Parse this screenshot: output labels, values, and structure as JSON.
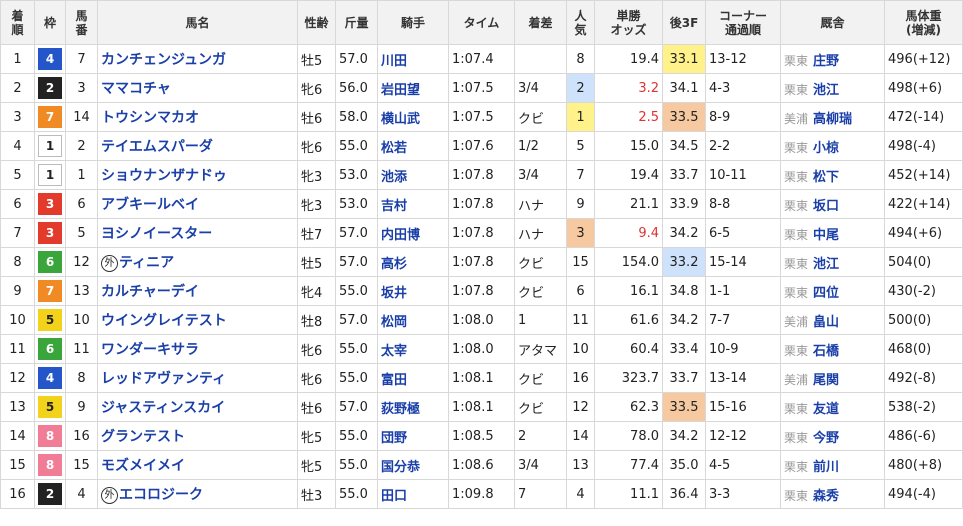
{
  "headers": {
    "rank": "着順",
    "waku": "枠",
    "umaban": "馬番",
    "horse": "馬名",
    "sexage": "性齢",
    "weight": "斤量",
    "jockey": "騎手",
    "time": "タイム",
    "margin": "着差",
    "popularity": "人気",
    "odds": "単勝オッズ",
    "last3f": "後3F",
    "corner": "コーナー通過順",
    "trainer": "厩舎",
    "bodyweight": "馬体重(増減)"
  },
  "header_parts": {
    "rank_1": "着",
    "rank_2": "順",
    "umaban_1": "馬",
    "umaban_2": "番",
    "pop_1": "人",
    "pop_2": "気",
    "odds_1": "単勝",
    "odds_2": "オッズ",
    "corner_1": "コーナー",
    "corner_2": "通過順",
    "bw_1": "馬体重",
    "bw_2": "(増減)"
  },
  "gai_mark": "外",
  "waku_colors": {
    "1": {
      "bg": "#ffffff",
      "fg": "#222222",
      "border": "#bbbbbb"
    },
    "2": {
      "bg": "#222222",
      "fg": "#ffffff",
      "border": "#222222"
    },
    "3": {
      "bg": "#e23b2c",
      "fg": "#ffffff",
      "border": "#e23b2c"
    },
    "4": {
      "bg": "#2456c9",
      "fg": "#ffffff",
      "border": "#2456c9"
    },
    "5": {
      "bg": "#f2d21b",
      "fg": "#222222",
      "border": "#f2d21b"
    },
    "6": {
      "bg": "#3aa53a",
      "fg": "#ffffff",
      "border": "#3aa53a"
    },
    "7": {
      "bg": "#f08a25",
      "fg": "#ffffff",
      "border": "#f08a25"
    },
    "8": {
      "bg": "#f07c96",
      "fg": "#ffffff",
      "border": "#f07c96"
    }
  },
  "rows": [
    {
      "rank": "1",
      "waku": "4",
      "umaban": "7",
      "horse": "カンチェンジュンガ",
      "gai": false,
      "sexage": "牡5",
      "weight": "57.0",
      "jockey": "川田",
      "time": "1:07.4",
      "margin": "",
      "pop": "8",
      "pop_hl": "",
      "odds": "19.4",
      "odds_red": false,
      "last3f": "33.1",
      "l3_hl": "yellow",
      "corner": "13-12",
      "area": "栗東",
      "trainer": "庄野",
      "bw": "496(+12)"
    },
    {
      "rank": "2",
      "waku": "2",
      "umaban": "3",
      "horse": "ママコチャ",
      "gai": false,
      "sexage": "牝6",
      "weight": "56.0",
      "jockey": "岩田望",
      "time": "1:07.5",
      "margin": "3/4",
      "pop": "2",
      "pop_hl": "blue",
      "odds": "3.2",
      "odds_red": true,
      "last3f": "34.1",
      "l3_hl": "",
      "corner": "4-3",
      "area": "栗東",
      "trainer": "池江",
      "bw": "498(+6)"
    },
    {
      "rank": "3",
      "waku": "7",
      "umaban": "14",
      "horse": "トウシンマカオ",
      "gai": false,
      "sexage": "牡6",
      "weight": "58.0",
      "jockey": "横山武",
      "time": "1:07.5",
      "margin": "クビ",
      "pop": "1",
      "pop_hl": "yellow",
      "odds": "2.5",
      "odds_red": true,
      "last3f": "33.5",
      "l3_hl": "orange",
      "corner": "8-9",
      "area": "美浦",
      "trainer": "高柳瑞",
      "bw": "472(-14)"
    },
    {
      "rank": "4",
      "waku": "1",
      "umaban": "2",
      "horse": "テイエムスパーダ",
      "gai": false,
      "sexage": "牝6",
      "weight": "55.0",
      "jockey": "松若",
      "time": "1:07.6",
      "margin": "1/2",
      "pop": "5",
      "pop_hl": "",
      "odds": "15.0",
      "odds_red": false,
      "last3f": "34.5",
      "l3_hl": "",
      "corner": "2-2",
      "area": "栗東",
      "trainer": "小椋",
      "bw": "498(-4)"
    },
    {
      "rank": "5",
      "waku": "1",
      "umaban": "1",
      "horse": "ショウナンザナドゥ",
      "gai": false,
      "sexage": "牝3",
      "weight": "53.0",
      "jockey": "池添",
      "time": "1:07.8",
      "margin": "3/4",
      "pop": "7",
      "pop_hl": "",
      "odds": "19.4",
      "odds_red": false,
      "last3f": "33.7",
      "l3_hl": "",
      "corner": "10-11",
      "area": "栗東",
      "trainer": "松下",
      "bw": "452(+14)"
    },
    {
      "rank": "6",
      "waku": "3",
      "umaban": "6",
      "horse": "アブキールベイ",
      "gai": false,
      "sexage": "牝3",
      "weight": "53.0",
      "jockey": "吉村",
      "time": "1:07.8",
      "margin": "ハナ",
      "pop": "9",
      "pop_hl": "",
      "odds": "21.1",
      "odds_red": false,
      "last3f": "33.9",
      "l3_hl": "",
      "corner": "8-8",
      "area": "栗東",
      "trainer": "坂口",
      "bw": "422(+14)"
    },
    {
      "rank": "7",
      "waku": "3",
      "umaban": "5",
      "horse": "ヨシノイースター",
      "gai": false,
      "sexage": "牡7",
      "weight": "57.0",
      "jockey": "内田博",
      "time": "1:07.8",
      "margin": "ハナ",
      "pop": "3",
      "pop_hl": "orange",
      "odds": "9.4",
      "odds_red": true,
      "last3f": "34.2",
      "l3_hl": "",
      "corner": "6-5",
      "area": "栗東",
      "trainer": "中尾",
      "bw": "494(+6)"
    },
    {
      "rank": "8",
      "waku": "6",
      "umaban": "12",
      "horse": "ティニア",
      "gai": true,
      "sexage": "牡5",
      "weight": "57.0",
      "jockey": "高杉",
      "time": "1:07.8",
      "margin": "クビ",
      "pop": "15",
      "pop_hl": "",
      "odds": "154.0",
      "odds_red": false,
      "last3f": "33.2",
      "l3_hl": "blue",
      "corner": "15-14",
      "area": "栗東",
      "trainer": "池江",
      "bw": "504(0)"
    },
    {
      "rank": "9",
      "waku": "7",
      "umaban": "13",
      "horse": "カルチャーデイ",
      "gai": false,
      "sexage": "牝4",
      "weight": "55.0",
      "jockey": "坂井",
      "time": "1:07.8",
      "margin": "クビ",
      "pop": "6",
      "pop_hl": "",
      "odds": "16.1",
      "odds_red": false,
      "last3f": "34.8",
      "l3_hl": "",
      "corner": "1-1",
      "area": "栗東",
      "trainer": "四位",
      "bw": "430(-2)"
    },
    {
      "rank": "10",
      "waku": "5",
      "umaban": "10",
      "horse": "ウイングレイテスト",
      "gai": false,
      "sexage": "牡8",
      "weight": "57.0",
      "jockey": "松岡",
      "time": "1:08.0",
      "margin": "1",
      "pop": "11",
      "pop_hl": "",
      "odds": "61.6",
      "odds_red": false,
      "last3f": "34.2",
      "l3_hl": "",
      "corner": "7-7",
      "area": "美浦",
      "trainer": "畠山",
      "bw": "500(0)"
    },
    {
      "rank": "11",
      "waku": "6",
      "umaban": "11",
      "horse": "ワンダーキサラ",
      "gai": false,
      "sexage": "牝6",
      "weight": "55.0",
      "jockey": "太宰",
      "time": "1:08.0",
      "margin": "アタマ",
      "pop": "10",
      "pop_hl": "",
      "odds": "60.4",
      "odds_red": false,
      "last3f": "33.4",
      "l3_hl": "",
      "corner": "10-9",
      "area": "栗東",
      "trainer": "石橋",
      "bw": "468(0)"
    },
    {
      "rank": "12",
      "waku": "4",
      "umaban": "8",
      "horse": "レッドアヴァンティ",
      "gai": false,
      "sexage": "牝6",
      "weight": "55.0",
      "jockey": "富田",
      "time": "1:08.1",
      "margin": "クビ",
      "pop": "16",
      "pop_hl": "",
      "odds": "323.7",
      "odds_red": false,
      "last3f": "33.7",
      "l3_hl": "",
      "corner": "13-14",
      "area": "美浦",
      "trainer": "尾関",
      "bw": "492(-8)"
    },
    {
      "rank": "13",
      "waku": "5",
      "umaban": "9",
      "horse": "ジャスティンスカイ",
      "gai": false,
      "sexage": "牡6",
      "weight": "57.0",
      "jockey": "荻野極",
      "time": "1:08.1",
      "margin": "クビ",
      "pop": "12",
      "pop_hl": "",
      "odds": "62.3",
      "odds_red": false,
      "last3f": "33.5",
      "l3_hl": "orange",
      "corner": "15-16",
      "area": "栗東",
      "trainer": "友道",
      "bw": "538(-2)"
    },
    {
      "rank": "14",
      "waku": "8",
      "umaban": "16",
      "horse": "グランテスト",
      "gai": false,
      "sexage": "牝5",
      "weight": "55.0",
      "jockey": "団野",
      "time": "1:08.5",
      "margin": "2",
      "pop": "14",
      "pop_hl": "",
      "odds": "78.0",
      "odds_red": false,
      "last3f": "34.2",
      "l3_hl": "",
      "corner": "12-12",
      "area": "栗東",
      "trainer": "今野",
      "bw": "486(-6)"
    },
    {
      "rank": "15",
      "waku": "8",
      "umaban": "15",
      "horse": "モズメイメイ",
      "gai": false,
      "sexage": "牝5",
      "weight": "55.0",
      "jockey": "国分恭",
      "time": "1:08.6",
      "margin": "3/4",
      "pop": "13",
      "pop_hl": "",
      "odds": "77.4",
      "odds_red": false,
      "last3f": "35.0",
      "l3_hl": "",
      "corner": "4-5",
      "area": "栗東",
      "trainer": "前川",
      "bw": "480(+8)"
    },
    {
      "rank": "16",
      "waku": "2",
      "umaban": "4",
      "horse": "エコロジーク",
      "gai": true,
      "sexage": "牡3",
      "weight": "55.0",
      "jockey": "田口",
      "time": "1:09.8",
      "margin": "7",
      "pop": "4",
      "pop_hl": "",
      "odds": "11.1",
      "odds_red": false,
      "last3f": "36.4",
      "l3_hl": "",
      "corner": "3-3",
      "area": "栗東",
      "trainer": "森秀",
      "bw": "494(-4)"
    }
  ]
}
